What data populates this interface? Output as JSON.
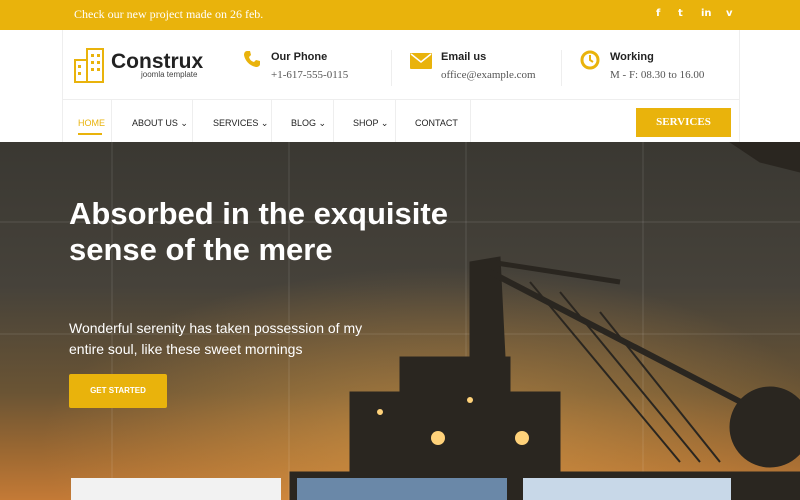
{
  "topbar": {
    "message": "Check our new project made on 26 feb.",
    "social": [
      {
        "label": "f",
        "icon": "facebook-icon"
      },
      {
        "label": "t",
        "icon": "twitter-icon"
      },
      {
        "label": "in",
        "icon": "linkedin-icon"
      },
      {
        "label": "v",
        "icon": "vimeo-icon"
      }
    ]
  },
  "brand": {
    "name": "Construx",
    "tagline": "joomla template"
  },
  "contact": [
    {
      "title": "Our Phone",
      "value": "+1-617-555-0115",
      "icon": "phone-icon"
    },
    {
      "title": "Email us",
      "value": "office@example.com",
      "icon": "envelope-icon"
    },
    {
      "title": "Working",
      "value": "M - F: 08.30 to 16.00",
      "icon": "clock-icon"
    }
  ],
  "nav": {
    "items": [
      "HOME",
      "ABOUT US",
      "SERVICES",
      "BLOG",
      "SHOP",
      "CONTACT"
    ],
    "active": "HOME",
    "services_button": "SERVICES"
  },
  "hero": {
    "title": "Absorbed in the exquisite sense of the mere",
    "subtitle": "Wonderful serenity has taken possession of my entire soul, like these sweet mornings",
    "cta": "GET STARTED"
  },
  "colors": {
    "accent": "#e9b30c",
    "text": "#222222"
  }
}
